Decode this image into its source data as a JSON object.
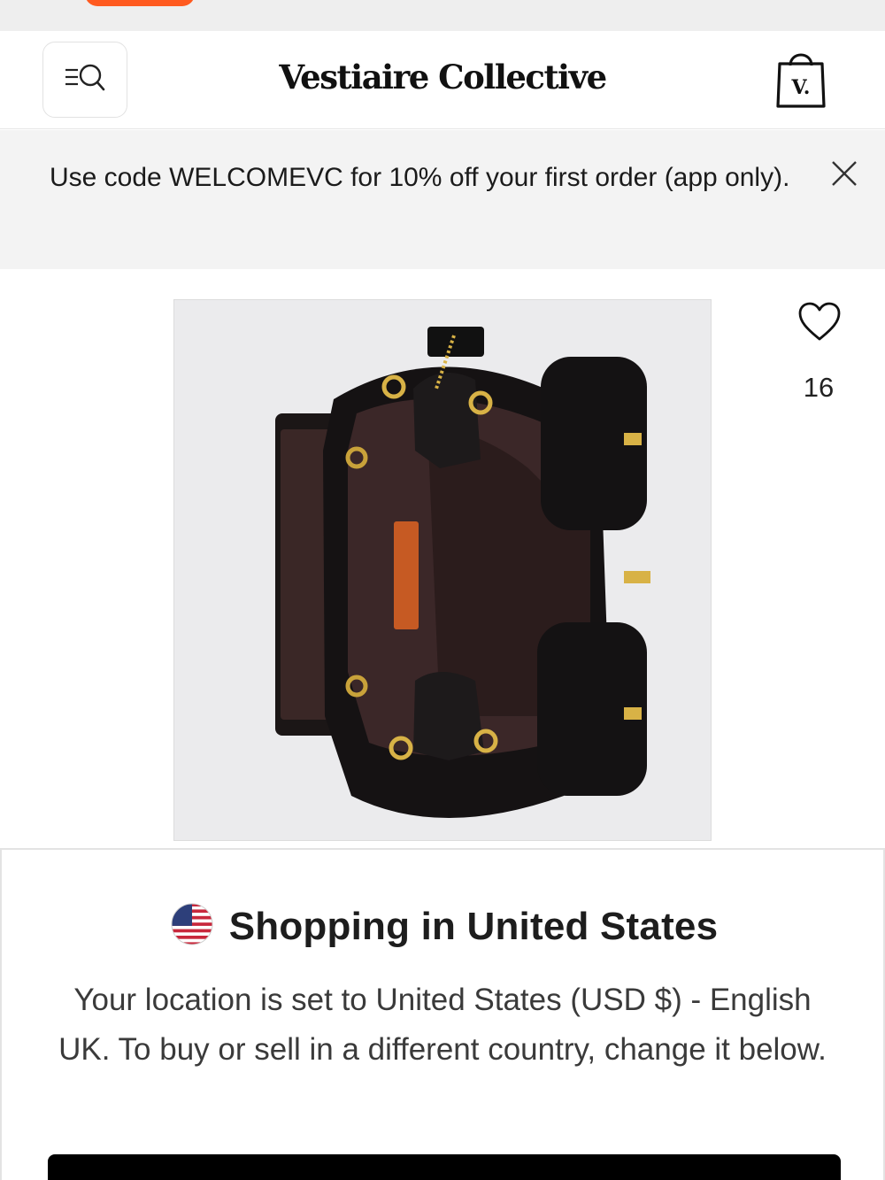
{
  "header": {
    "brand": "Vestiaire Collective",
    "bag_letter": "V."
  },
  "icons": {
    "menu_search": "menu-search-icon",
    "bag": "shopping-bag-icon",
    "close": "close-icon",
    "heart": "heart-outline-icon",
    "flag": "us-flag-icon"
  },
  "promo": {
    "text": "Use code WELCOMEVC for 10% off your first order (app only)."
  },
  "product": {
    "favorites_count": "16"
  },
  "country_modal": {
    "title": "Shopping in United States",
    "body": "Your location is set to United States (USD $) - English UK. To buy or sell in a different country, change it below."
  },
  "colors": {
    "accent_orange": "#ff5a1f",
    "primary_button": "#000000",
    "banner_bg": "#f3f3f3"
  }
}
